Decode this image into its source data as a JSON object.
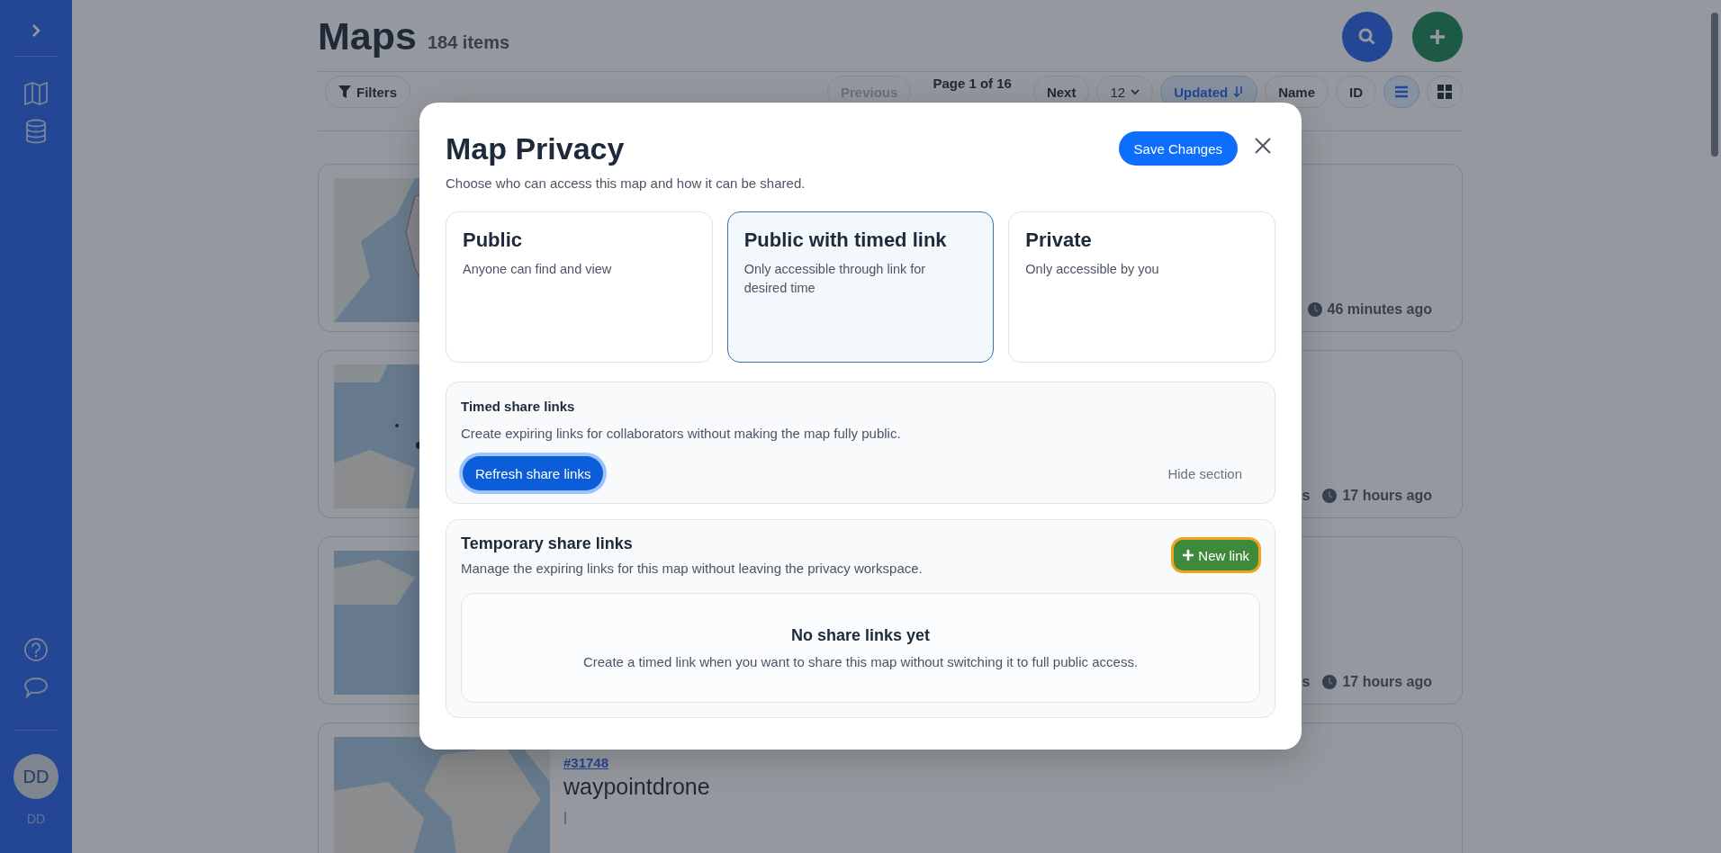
{
  "sidebar": {
    "user": {
      "initials": "DD",
      "label": "DD"
    }
  },
  "header": {
    "title": "Maps",
    "count": "184 items"
  },
  "toolbar": {
    "filters": "Filters",
    "previous": {
      "label": "Previous",
      "disabled": true
    },
    "page": "Page 1 of 16",
    "next": {
      "label": "Next",
      "disabled": false
    },
    "per_page": "12",
    "sort_options": [
      {
        "label": "Updated",
        "selected": true
      },
      {
        "label": "Name",
        "selected": false
      },
      {
        "label": "ID",
        "selected": false
      }
    ],
    "views": [
      {
        "kind": "list",
        "selected": true
      },
      {
        "kind": "grid",
        "selected": false
      }
    ]
  },
  "cards": [
    {
      "meta": [
        "46 minutes ago"
      ]
    },
    {
      "meta_fragment": "s",
      "meta": [
        "17 hours ago"
      ]
    },
    {
      "meta_fragment": "s",
      "meta": [
        "17 hours ago"
      ]
    },
    {
      "id": "#31748",
      "title": "waypointdrone",
      "description": "|"
    }
  ],
  "modal": {
    "title": "Map Privacy",
    "subtitle": "Choose who can access this map and how it can be shared.",
    "save": "Save Changes",
    "options": [
      {
        "title": "Public",
        "description": "Anyone can find and view",
        "selected": false
      },
      {
        "title": "Public with timed link",
        "description": "Only accessible through link for desired time",
        "selected": true
      },
      {
        "title": "Private",
        "description": "Only accessible by you",
        "selected": false
      }
    ],
    "timed_section": {
      "title": "Timed share links",
      "description": "Create expiring links for collaborators without making the map fully public.",
      "refresh": "Refresh share links",
      "hide": "Hide section"
    },
    "temporary_section": {
      "title": "Temporary share links",
      "description": "Manage the expiring links for this map without leaving the privacy workspace.",
      "new_link": "New link",
      "empty_title": "No share links yet",
      "empty_message": "Create a timed link when you want to share this map without switching it to full public access."
    }
  }
}
